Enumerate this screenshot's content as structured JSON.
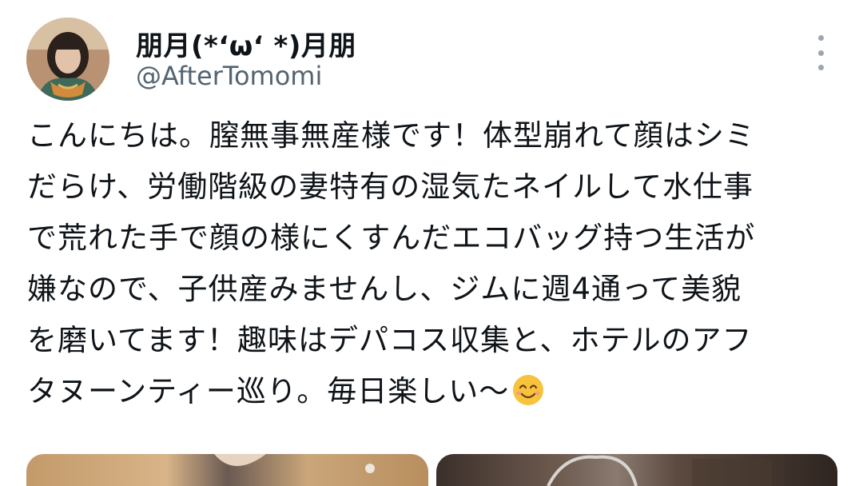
{
  "tweet": {
    "display_name": "朋月(*‘ω‘ *)月朋",
    "handle": "@AfterTomomi",
    "more_icon": "more-vertical-icon",
    "body_lines": [
      "こんにちは。膣無事無産様です！体型崩れて顔はシミ",
      "だらけ、労働階級の妻特有の湿気たネイルして水仕事",
      "で荒れた手で顔の様にくすんだエコバッグ持つ生活が",
      "嫌なので、子供産みませんし、ジムに週4通って美貌",
      "を磨いてます！趣味はデパコス収集と、ホテルのアフ",
      "タヌーンティー巡り。毎日楽しい〜"
    ],
    "emoji": "smiling-face-emoji",
    "media_count": 2
  },
  "colors": {
    "text": "#0f1419",
    "secondary": "#536471",
    "emoji_face": "#f7c33c"
  }
}
